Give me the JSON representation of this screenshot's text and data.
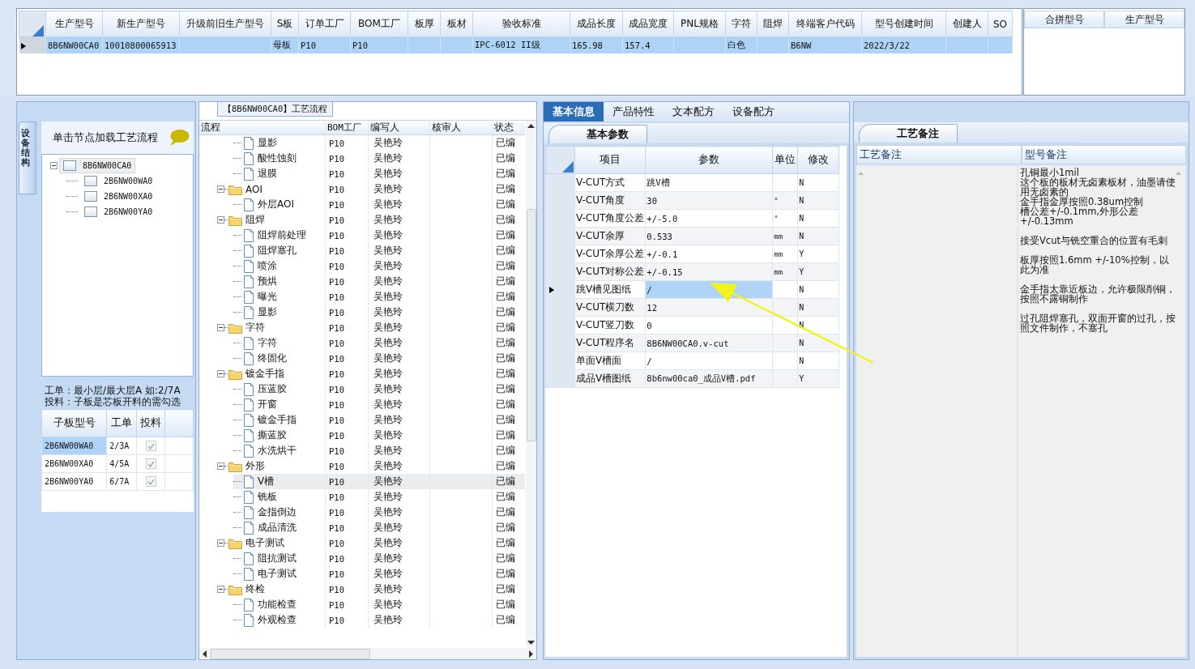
{
  "top_grid": {
    "columns": [
      "生产型号",
      "新生产型号",
      "升级前旧生产型号",
      "S板",
      "订单工厂",
      "BOM工厂",
      "板厚",
      "板材",
      "验收标准",
      "成品长度",
      "成品宽度",
      "PNL规格",
      "字符",
      "阻焊",
      "终端客户代码",
      "型号创建时间",
      "创建人",
      "SO"
    ],
    "rows": [
      {
        "current": true,
        "selected": true,
        "cells": [
          "8B6NW00CA0",
          "10010800065913",
          null,
          "母板",
          "P10",
          "P10",
          null,
          null,
          "IPC-6012 II级",
          "165.98",
          "157.4",
          null,
          "白色",
          null,
          "B6NW",
          "2022/3/22",
          null,
          null
        ]
      }
    ]
  },
  "merge_grid": {
    "columns": [
      "合拼型号",
      "生产型号"
    ]
  },
  "structure_panel": {
    "side_tab": "设备结构",
    "hint": "单击节点加载工艺流程",
    "tree": [
      {
        "label": "8B6NW00CA0",
        "expanded": true,
        "selected": true,
        "children": [
          {
            "label": "2B6NW00WA0",
            "selected": false
          },
          {
            "label": "2B6NW00XA0",
            "selected": false
          },
          {
            "label": "2B6NW00YA0",
            "selected": false
          }
        ]
      }
    ],
    "note_lines": [
      "工单：最小层/最大层A 如:2/7A",
      "投料：子板是芯板开料的需勾选"
    ],
    "sub_grid": {
      "columns": [
        "子板型号",
        "工单",
        "投料"
      ],
      "rows": [
        {
          "board": "2B6NW00WA0",
          "order": "2/3A",
          "checked": true,
          "selected": true
        },
        {
          "board": "2B6NW00XA0",
          "order": "4/5A",
          "checked": true,
          "selected": false
        },
        {
          "board": "2B6NW00YA0",
          "order": "6/7A",
          "checked": true,
          "selected": false
        }
      ]
    }
  },
  "flow_panel": {
    "title": "【8B6NW00CA0】工艺流程",
    "columns": [
      "流程",
      "BOM工厂",
      "编写人",
      "核审人",
      "状态"
    ],
    "tree": [
      {
        "children": [
          {
            "name": "显影",
            "bom": "P10",
            "writer": "吴艳玲",
            "status": "已编",
            "selected": false
          },
          {
            "name": "酸性蚀刻",
            "bom": "P10",
            "writer": "吴艳玲",
            "status": "已编",
            "selected": false
          },
          {
            "name": "退膜",
            "bom": "P10",
            "writer": "吴艳玲",
            "status": "已编",
            "selected": false
          }
        ]
      },
      {
        "name": "AOI",
        "bom": "P10",
        "writer": "吴艳玲",
        "status": "已编",
        "selected": false,
        "expanded": true,
        "children": [
          {
            "name": "外层AOI",
            "bom": "P10",
            "writer": "吴艳玲",
            "status": "已编",
            "selected": false
          }
        ]
      },
      {
        "name": "阻焊",
        "bom": "P10",
        "writer": "吴艳玲",
        "status": "已编",
        "selected": false,
        "expanded": true,
        "children": [
          {
            "name": "阻焊前处理",
            "bom": "P10",
            "writer": "吴艳玲",
            "status": "已编",
            "selected": false
          },
          {
            "name": "阻焊塞孔",
            "bom": "P10",
            "writer": "吴艳玲",
            "status": "已编",
            "selected": false
          },
          {
            "name": "喷涂",
            "bom": "P10",
            "writer": "吴艳玲",
            "status": "已编",
            "selected": false
          },
          {
            "name": "预烘",
            "bom": "P10",
            "writer": "吴艳玲",
            "status": "已编",
            "selected": false
          },
          {
            "name": "曝光",
            "bom": "P10",
            "writer": "吴艳玲",
            "status": "已编",
            "selected": false
          },
          {
            "name": "显影",
            "bom": "P10",
            "writer": "吴艳玲",
            "status": "已编",
            "selected": false
          }
        ]
      },
      {
        "name": "字符",
        "bom": "P10",
        "writer": "吴艳玲",
        "status": "已编",
        "selected": false,
        "expanded": true,
        "children": [
          {
            "name": "字符",
            "bom": "P10",
            "writer": "吴艳玲",
            "status": "已编",
            "selected": false
          },
          {
            "name": "终固化",
            "bom": "P10",
            "writer": "吴艳玲",
            "status": "已编",
            "selected": false
          }
        ]
      },
      {
        "name": "镀金手指",
        "bom": "P10",
        "writer": "吴艳玲",
        "status": "已编",
        "selected": false,
        "expanded": true,
        "children": [
          {
            "name": "压蓝胶",
            "bom": "P10",
            "writer": "吴艳玲",
            "status": "已编",
            "selected": false
          },
          {
            "name": "开窗",
            "bom": "P10",
            "writer": "吴艳玲",
            "status": "已编",
            "selected": false
          },
          {
            "name": "镀金手指",
            "bom": "P10",
            "writer": "吴艳玲",
            "status": "已编",
            "selected": false
          },
          {
            "name": "撕蓝胶",
            "bom": "P10",
            "writer": "吴艳玲",
            "status": "已编",
            "selected": false
          },
          {
            "name": "水洗烘干",
            "bom": "P10",
            "writer": "吴艳玲",
            "status": "已编",
            "selected": false
          }
        ]
      },
      {
        "name": "外形",
        "bom": "P10",
        "writer": "吴艳玲",
        "status": "已编",
        "selected": false,
        "expanded": true,
        "children": [
          {
            "name": "V槽",
            "bom": "P10",
            "writer": "吴艳玲",
            "status": "已编",
            "selected": true
          },
          {
            "name": "铣板",
            "bom": "P10",
            "writer": "吴艳玲",
            "status": "已编",
            "selected": false
          },
          {
            "name": "金指倒边",
            "bom": "P10",
            "writer": "吴艳玲",
            "status": "已编",
            "selected": false
          },
          {
            "name": "成品清洗",
            "bom": "P10",
            "writer": "吴艳玲",
            "status": "已编",
            "selected": false
          }
        ]
      },
      {
        "name": "电子测试",
        "bom": "P10",
        "writer": "吴艳玲",
        "status": "已编",
        "selected": false,
        "expanded": true,
        "children": [
          {
            "name": "阻抗测试",
            "bom": "P10",
            "writer": "吴艳玲",
            "status": "已编",
            "selected": false
          },
          {
            "name": "电子测试",
            "bom": "P10",
            "writer": "吴艳玲",
            "status": "已编",
            "selected": false
          }
        ]
      },
      {
        "name": "终检",
        "bom": "P10",
        "writer": "吴艳玲",
        "status": "已编",
        "selected": false,
        "expanded": true,
        "children": [
          {
            "name": "功能检查",
            "bom": "P10",
            "writer": "吴艳玲",
            "status": "已编",
            "selected": false
          },
          {
            "name": "外观检查",
            "bom": "P10",
            "writer": "吴艳玲",
            "status": "已编",
            "selected": false
          }
        ]
      }
    ]
  },
  "info_panel": {
    "tabs": [
      {
        "label": "基本信息",
        "selected": true
      },
      {
        "label": "产品特性",
        "selected": false
      },
      {
        "label": "文本配方",
        "selected": false
      },
      {
        "label": "设备配方",
        "selected": false
      }
    ],
    "sub_tab": "基本参数",
    "columns": [
      "项目",
      "参数",
      "单位",
      "修改"
    ],
    "rows": [
      {
        "item": "V-CUT方式",
        "param": "跳V槽",
        "unit": null,
        "modified": "N",
        "current": false
      },
      {
        "item": "V-CUT角度",
        "param": "30",
        "unit": "°",
        "modified": "N",
        "current": false
      },
      {
        "item": "V-CUT角度公差",
        "param": "+/-5.0",
        "unit": "°",
        "modified": "N",
        "current": false
      },
      {
        "item": "V-CUT余厚",
        "param": "0.533",
        "unit": "mm",
        "modified": "N",
        "current": false
      },
      {
        "item": "V-CUT余厚公差",
        "param": "+/-0.1",
        "unit": "mm",
        "modified": "Y",
        "current": false
      },
      {
        "item": "V-CUT对称公差",
        "param": "+/-0.15",
        "unit": "mm",
        "modified": "Y",
        "current": false
      },
      {
        "item": "跳V槽见图纸",
        "param": "/",
        "unit": null,
        "modified": "N",
        "current": true
      },
      {
        "item": "V-CUT横刀数",
        "param": "12",
        "unit": null,
        "modified": "N",
        "current": false
      },
      {
        "item": "V-CUT竖刀数",
        "param": "0",
        "unit": null,
        "modified": "N",
        "current": false
      },
      {
        "item": "V-CUT程序名",
        "param": "8B6NW00CA0.v-cut",
        "unit": null,
        "modified": "N",
        "current": false
      },
      {
        "item": "单面V槽面",
        "param": "/",
        "unit": null,
        "modified": "N",
        "current": false
      },
      {
        "item": "成品V槽图纸",
        "param": "8b6nw00ca0_成品V槽.pdf",
        "unit": null,
        "modified": "Y",
        "current": false
      }
    ]
  },
  "notes_panel": {
    "tab": "工艺备注",
    "columns": [
      "工艺备注",
      "型号备注"
    ],
    "model_notes": [
      [
        "孔铜最小1mil",
        "这个板的板材无卤素板材，油墨请使用无卤素的",
        "金手指金厚按照0.38um控制",
        "槽公差+/-0.1mm,外形公差+/-0.13mm"
      ],
      [
        "接受Vcut与铣空重合的位置有毛刺"
      ],
      [
        "板厚按照1.6mm +/-10%控制，以此为准"
      ],
      [
        "金手指太靠近板边，允许极限削铜，按照不露铜制作"
      ],
      [
        "过孔阻焊塞孔，双面开窗的过孔，按照文件制作，不塞孔"
      ]
    ]
  },
  "annotation": {
    "kind": "arrow",
    "color": "#f2f21e"
  }
}
